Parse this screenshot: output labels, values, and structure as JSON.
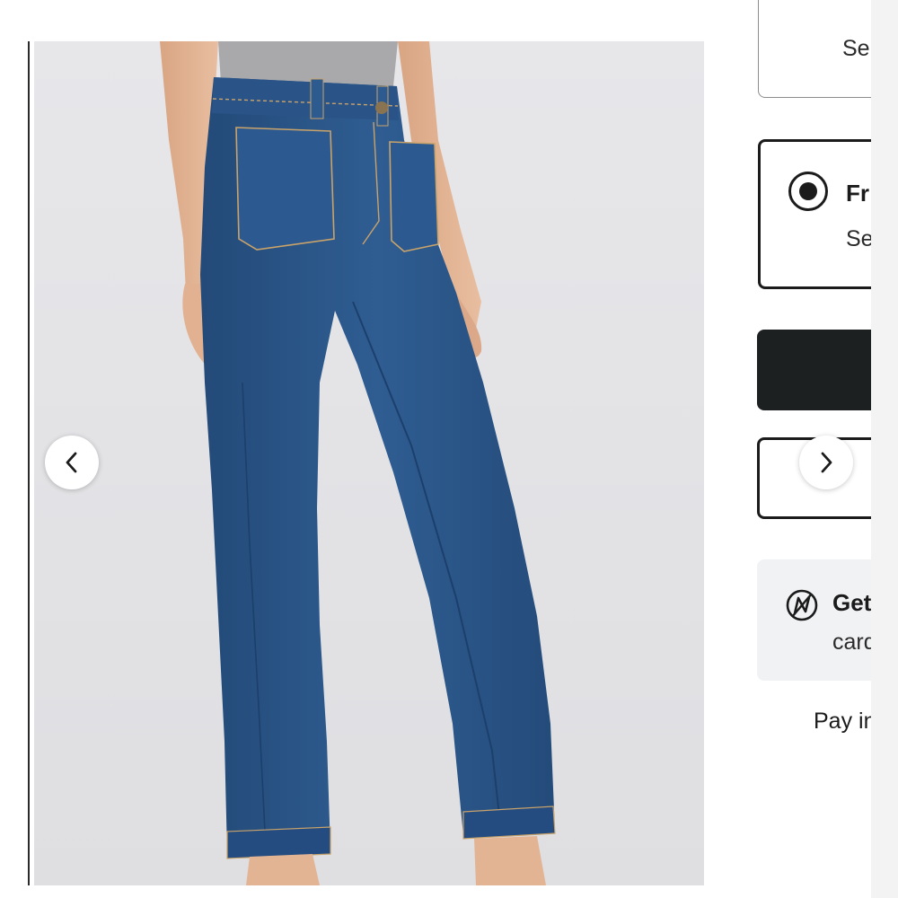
{
  "gallery": {
    "image_alt": "Woman wearing high-rise cropped flare jeans with patch pockets",
    "prev_button": {
      "icon": "chevron-left-icon"
    },
    "next_button": {
      "icon": "chevron-right-icon"
    }
  },
  "shipping": {
    "option_1": {
      "subtitle": "Se"
    },
    "option_2": {
      "title": "Fr",
      "subtitle": "Se",
      "selected": true
    }
  },
  "actions": {
    "primary_label": "",
    "secondary_label": ""
  },
  "promo": {
    "icon": "nordstrom-n-logo-icon",
    "title": "Get",
    "subtitle": "card"
  },
  "pay_text": "Pay in",
  "colors": {
    "primary_button": "#1d2021",
    "promo_background": "#f1f2f4",
    "denim": "#2d5a8e"
  }
}
